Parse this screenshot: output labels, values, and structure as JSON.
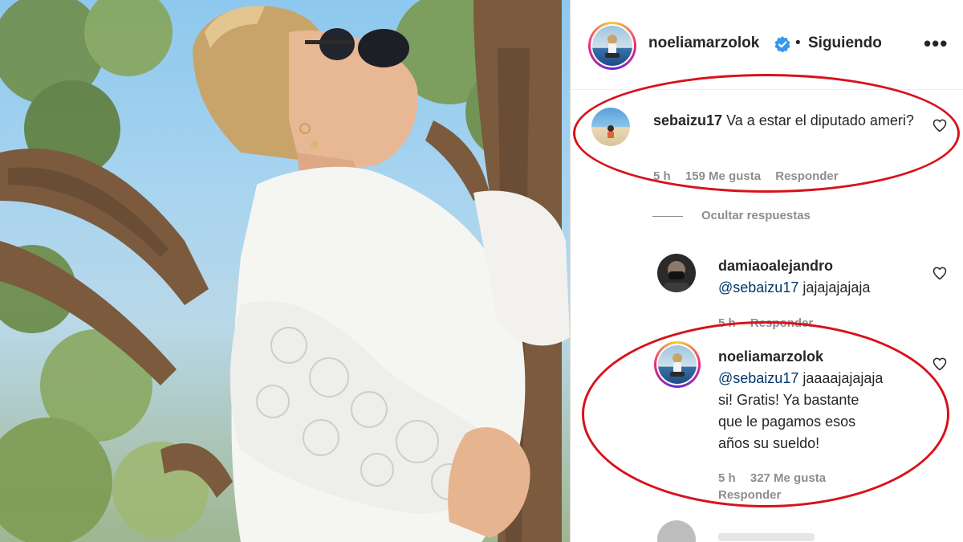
{
  "post": {
    "username": "noeliamarzolok",
    "separator": "•",
    "follow_status": "Siguiendo",
    "more_icon": "more-options-icon"
  },
  "comments": [
    {
      "username": "sebaizu17",
      "text": "Va a estar el diputado ameri?",
      "time": "5 h",
      "likes": "159 Me gusta",
      "reply": "Responder"
    }
  ],
  "hide_replies": "Ocultar respuestas",
  "replies": [
    {
      "username": "damiaoalejandro",
      "mention": "@sebaizu17",
      "text": "jajajajajaja",
      "time": "5 h",
      "reply": "Responder"
    },
    {
      "username": "noeliamarzolok",
      "mention": "@sebaizu17",
      "text_line1": "jaaaajajajaja",
      "text_line2": "si! Gratis! Ya bastante",
      "text_line3": "que le pagamos esos",
      "text_line4": "años su sueldo!",
      "time": "5 h",
      "likes": "327 Me gusta",
      "reply": "Responder"
    }
  ],
  "colors": {
    "annotation": "#d7121b",
    "mention": "#00376b",
    "verified": "#3897f0",
    "meta": "#8e8e8e"
  }
}
